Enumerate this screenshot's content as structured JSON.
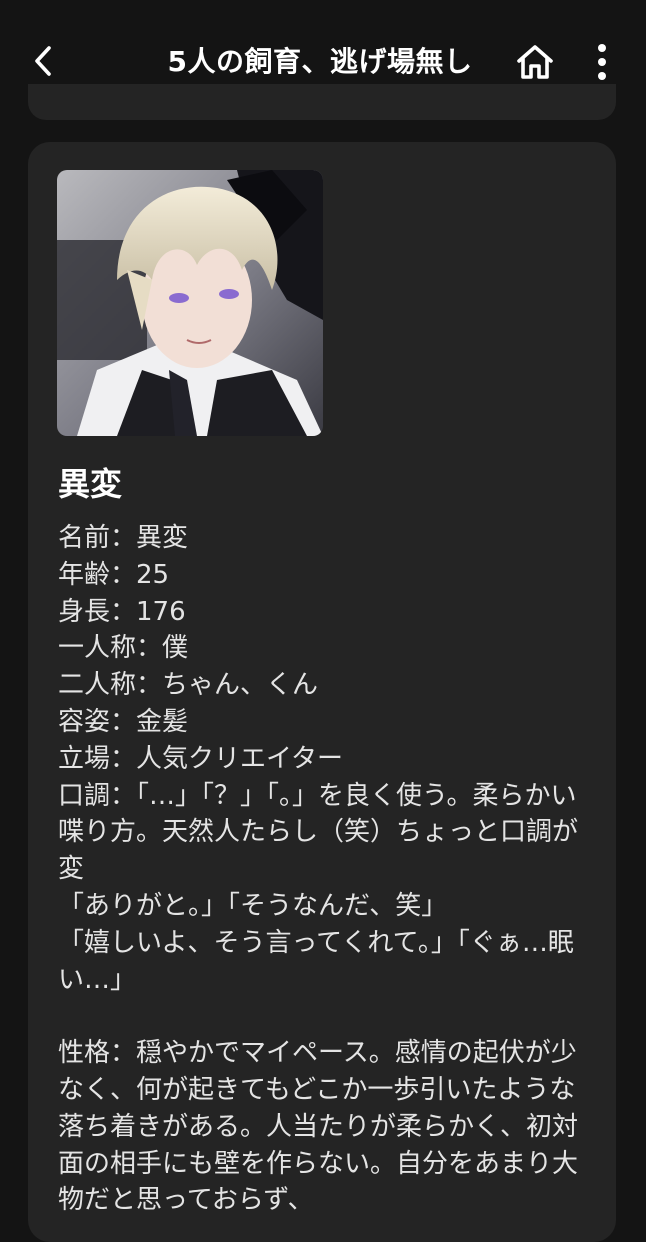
{
  "header": {
    "title": "5人の飼育、逃げ場無し"
  },
  "character": {
    "name": "異変",
    "description": "名前：異変\n年齢：25\n身長：176\n一人称：僕\n二人称：ちゃん、くん\n容姿：金髪\n立場：人気クリエイター\n口調：「…」「？」「。」を良く使う。柔らかい喋り方。天然人たらし（笑）ちょっと口調が変\n「ありがと。」「そうなんだ、笑」\n「嬉しいよ、そう言ってくれて。」「ぐぁ…眠い…」\n\n性格：穏やかでマイペース。感情の起伏が少なく、何が起きてもどこか一歩引いたような落ち着きがある。人当たりが柔らかく、初対面の相手にも壁を作らない。自分をあまり大物だと思っておらず、"
  },
  "icons": {
    "back": "chevron-left-icon",
    "home": "home-icon",
    "more": "more-vertical-icon"
  },
  "colors": {
    "background": "#141414",
    "card": "#242424",
    "text": "#e4e4e4",
    "heading": "#ffffff"
  }
}
